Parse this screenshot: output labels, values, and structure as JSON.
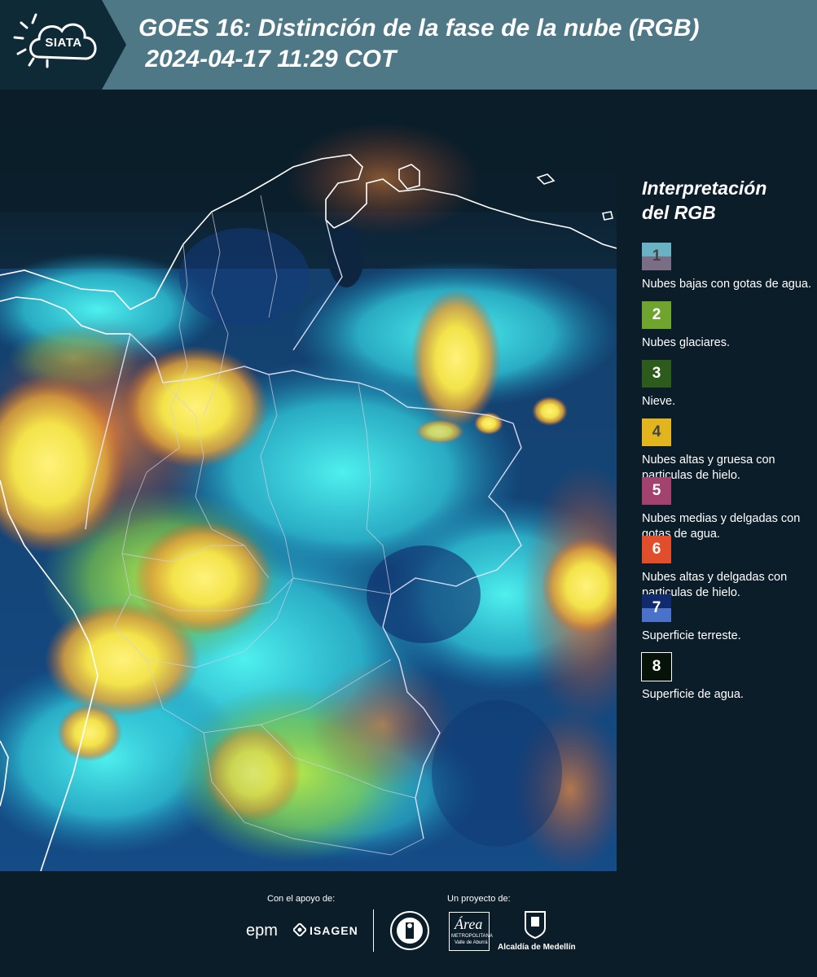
{
  "header": {
    "logo_text": "SIATA",
    "title_line1": "GOES 16: Distinción de la fase de la nube (RGB)",
    "title_line2": " 2024-04-17 11:29 COT"
  },
  "legend": {
    "title_line1": "Interpretación",
    "title_line2": "del RGB",
    "items": [
      {
        "number": "1",
        "label": "Nubes bajas con gotas de agua.",
        "color_top": "#6ab1c3",
        "color_bottom": "#7a6e86",
        "num_color": "#444444"
      },
      {
        "number": "2",
        "label": "Nubes glaciares.",
        "color_top": "#6fa42f",
        "color_bottom": "#6fa42f",
        "num_color": "#ffffff"
      },
      {
        "number": "3",
        "label": "Nieve.",
        "color_top": "#2d5b1b",
        "color_bottom": "#2d5b1b",
        "num_color": "#ffffff"
      },
      {
        "number": "4",
        "label": "Nubes altas y gruesa con particulas de hielo.",
        "color_top": "#e2b51f",
        "color_bottom": "#e2b51f",
        "num_color": "#444444"
      },
      {
        "number": "5",
        "label": "Nubes medias y delgadas con gotas de agua.",
        "color_top": "#a2426f",
        "color_bottom": "#a2426f",
        "num_color": "#ffffff"
      },
      {
        "number": "6",
        "label": "Nubes altas y delgadas con particulas de hielo.",
        "color_top": "#e04e2b",
        "color_bottom": "#e04e2b",
        "num_color": "#ffffff"
      },
      {
        "number": "7",
        "label": "Superficie terreste.",
        "color_top": "#112a6e",
        "color_bottom": "#4a72c8",
        "num_color": "#ffffff"
      },
      {
        "number": "8",
        "label": "Superficie de agua.",
        "color_top": "#071208",
        "color_bottom": "#071208",
        "num_color": "#ffffff"
      }
    ]
  },
  "footer": {
    "support_label": "Con el apoyo de:",
    "project_label": "Un proyecto de:",
    "epm_logo": "epm",
    "isagen_logo": "ISAGEN",
    "area_logo": "Área",
    "area_sub1": "METROPOLITANA",
    "area_sub2": "Valle de Aburrá",
    "alcaldia_logo": "Alcaldía de Medellín"
  },
  "colors": {
    "header_bg": "#4f7886",
    "logo_block_bg": "#0f2a37",
    "page_bg": "#0b1d29"
  }
}
